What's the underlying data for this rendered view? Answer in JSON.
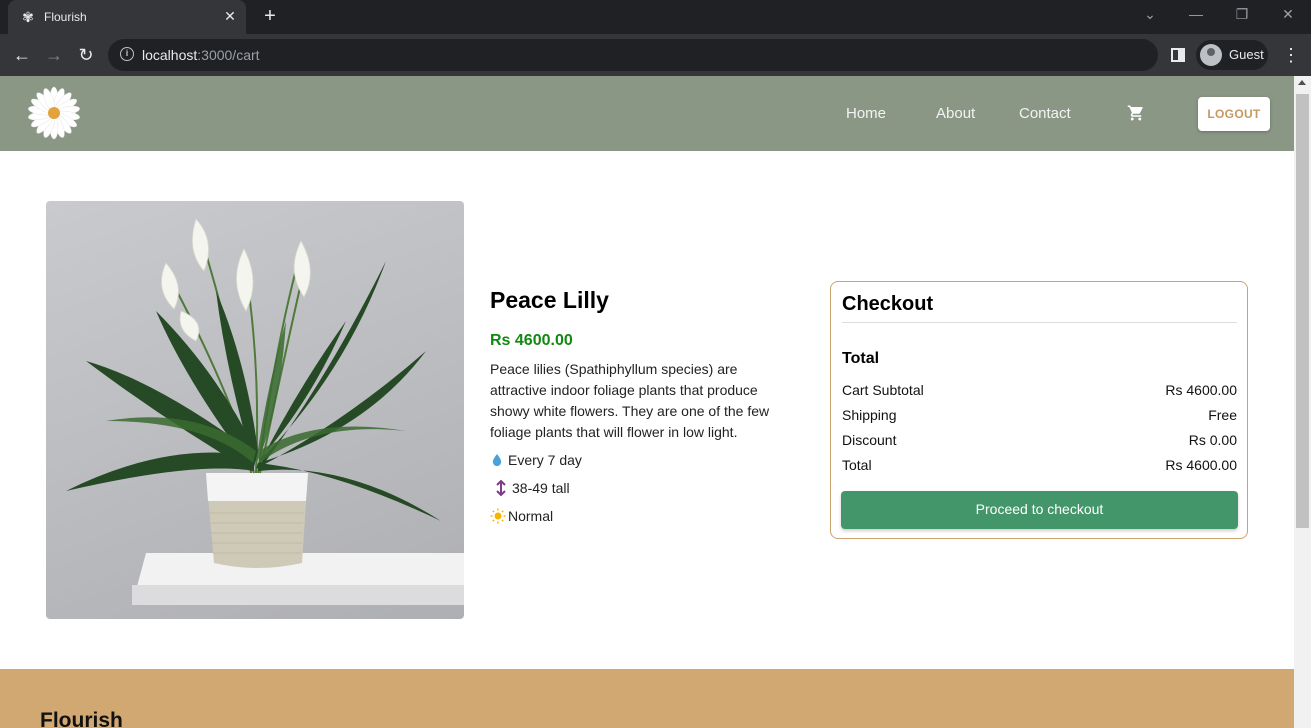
{
  "browser": {
    "tab_title": "Flourish",
    "url_host": "localhost",
    "url_path": ":3000/cart",
    "profile_name": "Guest"
  },
  "header": {
    "nav": [
      "Home",
      "About",
      "Contact"
    ],
    "logout_label": "LOGOUT",
    "bg_color": "#8a9785"
  },
  "product": {
    "name": "Peace Lilly",
    "price": "Rs 4600.00",
    "description": "Peace lilies (Spathiphyllum species) are attractive indoor foliage plants that produce showy white flowers. They are one of the few foliage plants that will flower in low light.",
    "water": "Every 7 day",
    "height": "38-49 tall",
    "light": "Normal",
    "price_color": "#108a10"
  },
  "checkout": {
    "title": "Checkout",
    "total_heading": "Total",
    "rows": [
      {
        "label": "Cart Subtotal",
        "value": "Rs 4600.00"
      },
      {
        "label": "Shipping",
        "value": "Free"
      },
      {
        "label": "Discount",
        "value": "Rs 0.00"
      },
      {
        "label": "Total",
        "value": "Rs 4600.00"
      }
    ],
    "button_label": "Proceed to checkout",
    "button_color": "#43966a",
    "border_color": "#c9a46f"
  },
  "footer": {
    "title": "Flourish",
    "bg_color": "#d2a872"
  },
  "icons": {
    "water": "water-drop-icon",
    "height": "height-arrow-icon",
    "light": "sun-icon",
    "cart": "cart-icon"
  }
}
